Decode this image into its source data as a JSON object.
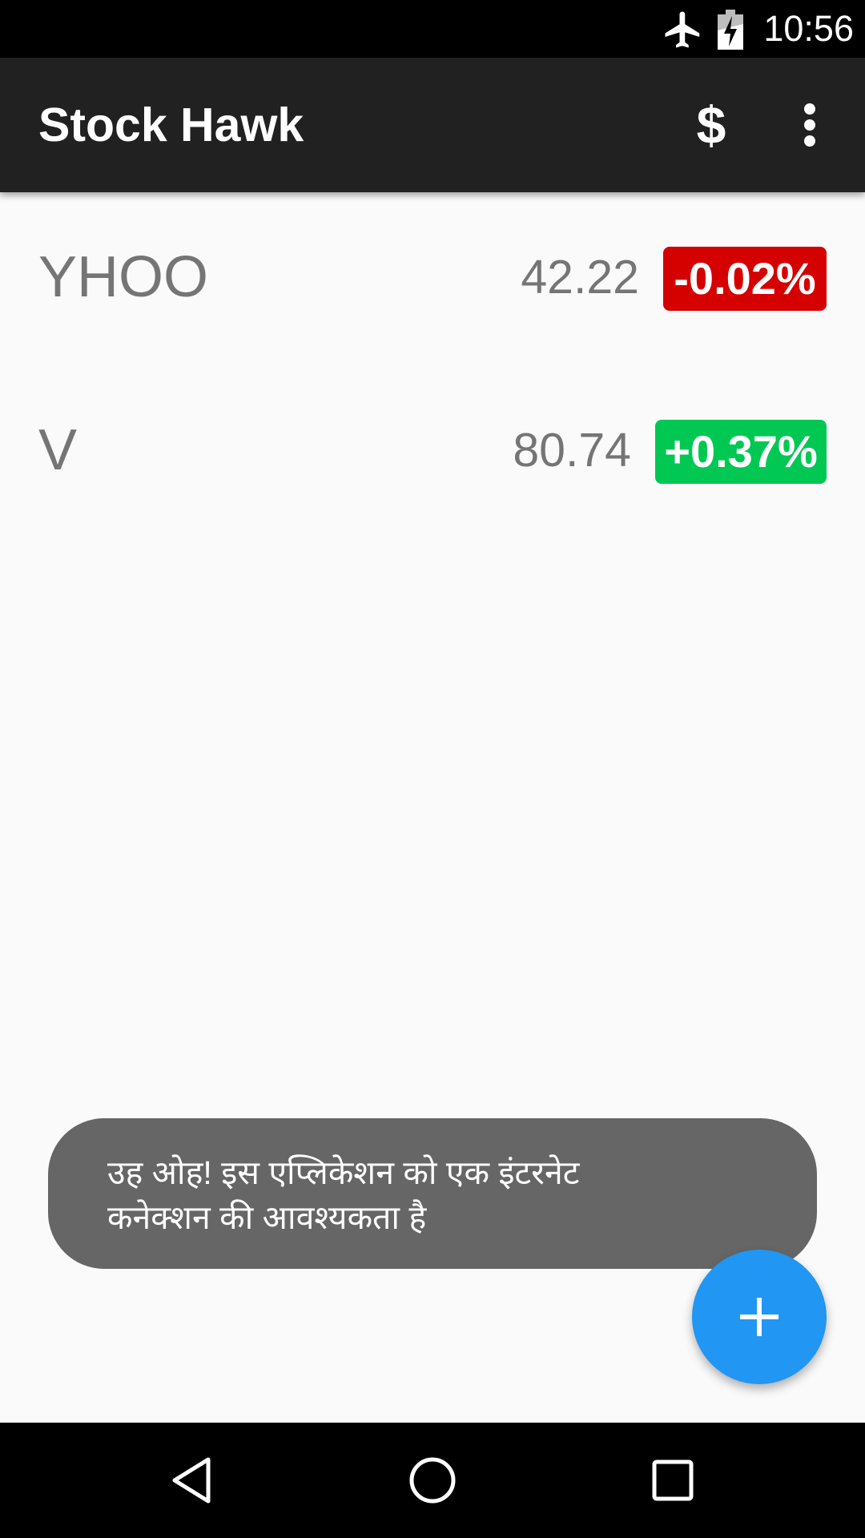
{
  "status_bar": {
    "time": "10:56",
    "icons": [
      "airplane-mode-icon",
      "battery-charging-icon"
    ]
  },
  "app_bar": {
    "title": "Stock Hawk",
    "currency_label": "$",
    "menu_icon": "more-vert-icon"
  },
  "stocks": [
    {
      "symbol": "YHOO",
      "price": "42.22",
      "change": "-0.02%",
      "direction": "down",
      "color": "#d50000"
    },
    {
      "symbol": "V",
      "price": "80.74",
      "change": "+0.37%",
      "direction": "up",
      "color": "#00c853"
    }
  ],
  "toast": {
    "message_line1": "उह ओह! इस एप्लिकेशन को एक इंटरनेट",
    "message_line2": "कनेक्शन की आवश्यकता है"
  },
  "fab": {
    "icon": "add-icon",
    "color": "#2196f3"
  },
  "nav_bar": {
    "buttons": [
      "back-icon",
      "home-icon",
      "recents-icon"
    ]
  }
}
